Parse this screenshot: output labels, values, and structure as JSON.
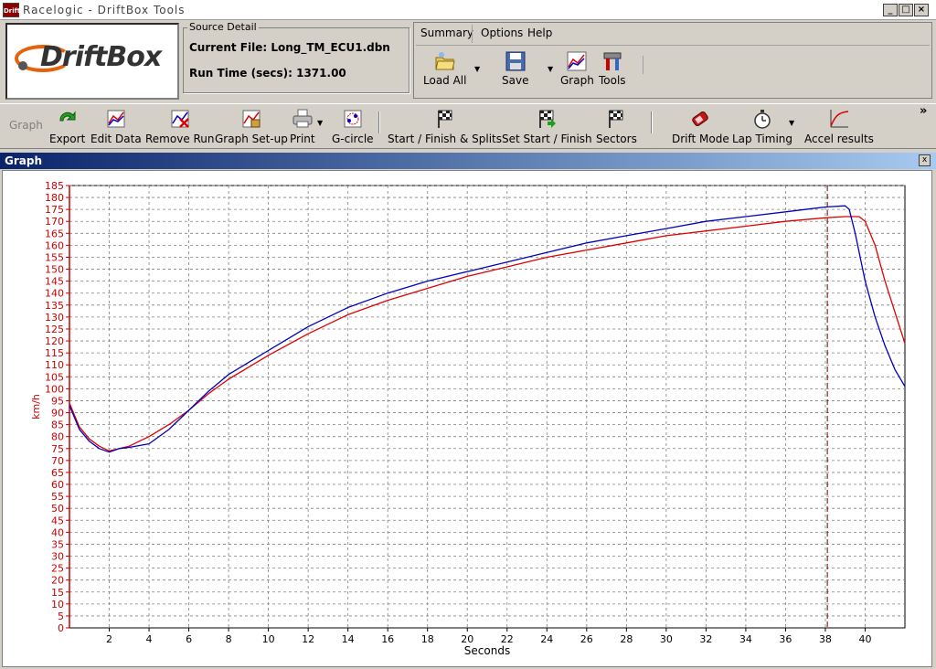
{
  "window": {
    "title": "Racelogic - DriftBox Tools",
    "icon_text": "Drift"
  },
  "logo": {
    "text": "DriftBox"
  },
  "source_detail": {
    "legend": "Source Detail",
    "current_file": "Current File: Long_TM_ECU1.dbn",
    "run_time": "Run Time (secs): 1371.00"
  },
  "menu": {
    "tabs": [
      "Summary",
      "Options",
      "Help"
    ],
    "buttons": [
      {
        "label": "Load All",
        "icon": "folder-open-icon"
      },
      {
        "label": "Save",
        "icon": "floppy-disk-icon"
      },
      {
        "label": "Graph",
        "icon": "graph-icon"
      },
      {
        "label": "Tools",
        "icon": "tools-icon"
      }
    ]
  },
  "toolbar": {
    "section_label": "Graph",
    "buttons": [
      {
        "label": "Export",
        "icon": "export-arrow-icon"
      },
      {
        "label": "Edit Data",
        "icon": "edit-data-icon"
      },
      {
        "label": "Remove Run",
        "icon": "remove-run-icon"
      },
      {
        "label": "Graph Set-up",
        "icon": "graph-setup-icon"
      },
      {
        "label": "Print",
        "icon": "printer-icon"
      },
      {
        "label": "G-circle",
        "icon": "g-circle-icon"
      },
      {
        "label": "Start / Finish & Splits",
        "icon": "checkered-flag-icon"
      },
      {
        "label": "Set Start / Finish",
        "icon": "checkered-flag-green-icon"
      },
      {
        "label": "Sectors",
        "icon": "checkered-flag-icon"
      },
      {
        "label": "Drift Mode",
        "icon": "drift-car-icon"
      },
      {
        "label": "Lap Timing",
        "icon": "stopwatch-icon"
      },
      {
        "label": "Accel results",
        "icon": "accel-curve-icon"
      }
    ],
    "overflow": "»"
  },
  "graph_window": {
    "title": "Graph",
    "close": "x"
  },
  "colors": {
    "series_red": "#e00000",
    "series_blue": "#0000c0",
    "axis_label": "#cc0000",
    "grid": "#808080"
  },
  "chart_data": {
    "type": "line",
    "xlabel": "Seconds",
    "ylabel": "km/h",
    "xlim": [
      0,
      42
    ],
    "ylim": [
      0,
      185
    ],
    "x_ticks": [
      2,
      4,
      6,
      8,
      10,
      12,
      14,
      16,
      18,
      20,
      22,
      24,
      26,
      28,
      30,
      32,
      34,
      36,
      38,
      40
    ],
    "y_ticks": [
      0,
      5,
      10,
      15,
      20,
      25,
      30,
      35,
      40,
      45,
      50,
      55,
      60,
      65,
      70,
      75,
      80,
      85,
      90,
      95,
      100,
      105,
      110,
      115,
      120,
      125,
      130,
      135,
      140,
      145,
      150,
      155,
      160,
      165,
      170,
      175,
      180,
      185
    ],
    "grid": true,
    "cursor_x": 38.1,
    "series": [
      {
        "color": "#e00000",
        "x": [
          0,
          0.5,
          1,
          1.5,
          2,
          2.5,
          3,
          4,
          5,
          6,
          7,
          8,
          9,
          10,
          12,
          14,
          16,
          18,
          20,
          22,
          24,
          26,
          28,
          30,
          32,
          34,
          36,
          38,
          39,
          39.7,
          40,
          40.5,
          41,
          41.5,
          42
        ],
        "y": [
          94,
          84,
          79,
          76,
          74,
          75,
          76,
          80,
          85,
          91,
          98,
          104,
          109,
          114,
          123,
          131,
          137,
          142,
          147,
          151,
          155,
          158,
          161,
          164,
          166,
          168,
          170,
          171.5,
          172,
          172,
          170,
          160,
          145,
          132,
          119
        ]
      },
      {
        "color": "#0000c0",
        "x": [
          0,
          0.5,
          1,
          1.5,
          2,
          2.5,
          3,
          4,
          5,
          6,
          7,
          8,
          9,
          10,
          12,
          14,
          16,
          18,
          20,
          22,
          24,
          26,
          28,
          30,
          32,
          34,
          36,
          38,
          39,
          39.2,
          39.5,
          40,
          40.5,
          41,
          41.5,
          42
        ],
        "y": [
          93,
          83,
          78,
          75,
          73.5,
          75,
          75.5,
          77,
          83,
          91,
          99,
          106,
          111,
          116,
          126,
          134,
          140,
          145,
          149,
          153,
          157,
          161,
          164,
          167,
          170,
          172,
          174,
          176,
          176.5,
          175,
          165,
          145,
          130,
          118,
          108,
          101
        ]
      }
    ]
  }
}
